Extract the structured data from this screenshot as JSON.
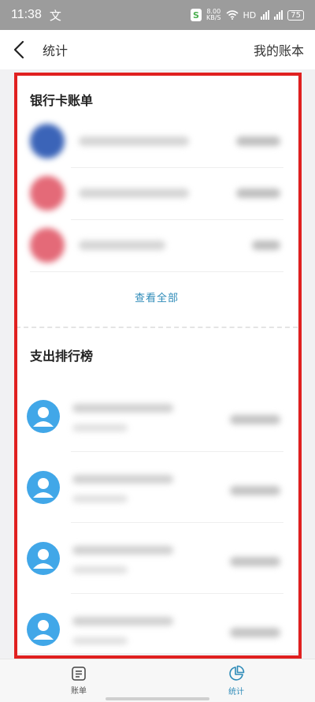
{
  "status_bar": {
    "time": "11:38",
    "app_badge": "文",
    "speed_value": "8.00",
    "speed_unit": "KB/S",
    "network": "HD",
    "battery": "75"
  },
  "header": {
    "title": "统计",
    "right_link": "我的账本"
  },
  "bank_section": {
    "title": "银行卡账单",
    "items": [
      {
        "color": "#3b64b8"
      },
      {
        "color": "#e46a78"
      },
      {
        "color": "#e46a78"
      }
    ],
    "view_all": "查看全部"
  },
  "ranking_section": {
    "title": "支出排行榜",
    "items": [
      {},
      {},
      {},
      {}
    ]
  },
  "bottom_nav": {
    "items": [
      {
        "label": "账单",
        "icon": "bill-icon"
      },
      {
        "label": "统计",
        "icon": "pie-chart-icon"
      }
    ]
  },
  "colors": {
    "accent": "#2e8bb8",
    "highlight": "#e02020",
    "avatar": "#41a7e8"
  }
}
